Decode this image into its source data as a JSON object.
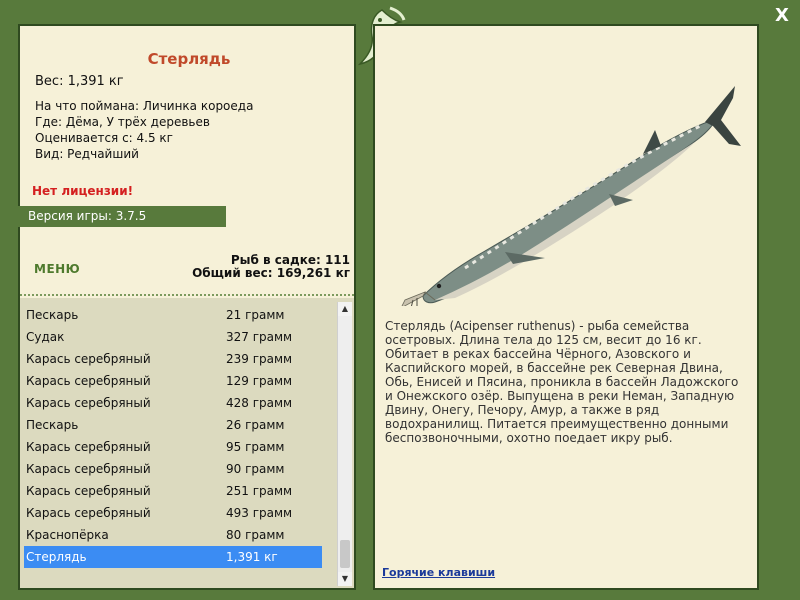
{
  "fish": {
    "name": "Стерлядь",
    "weight": "Вес: 1,391 кг",
    "info": [
      "На что поймана: Личинка короеда",
      "Где: Дёма, У трёх деревьев",
      "Оценивается с: 4.5 кг",
      "Вид: Редчайший"
    ]
  },
  "license_warning": "Нет лицензии!",
  "version": "Версия игры: 3.7.5",
  "menu_label": "МЕНЮ",
  "stats": {
    "count": "Рыб в садке: 111",
    "total": "Общий вес: 169,261 кг"
  },
  "catch_list": [
    {
      "name": "Пескарь",
      "weight": "21 грамм"
    },
    {
      "name": "Судак",
      "weight": "327 грамм"
    },
    {
      "name": "Карась серебряный",
      "weight": "239 грамм"
    },
    {
      "name": "Карась серебряный",
      "weight": "129 грамм"
    },
    {
      "name": "Карась серебряный",
      "weight": "428 грамм"
    },
    {
      "name": "Пескарь",
      "weight": "26 грамм"
    },
    {
      "name": "Карась серебряный",
      "weight": "95 грамм"
    },
    {
      "name": "Карась серебряный",
      "weight": "90 грамм"
    },
    {
      "name": "Карась серебряный",
      "weight": "251 грамм"
    },
    {
      "name": "Карась серебряный",
      "weight": "493 грамм"
    },
    {
      "name": "Краснопёрка",
      "weight": "80 грамм"
    },
    {
      "name": "Стерлядь",
      "weight": "1,391 кг",
      "selected": true
    }
  ],
  "description": "Стерлядь (Acipenser ruthenus) - рыба семейства осетровых. Длина тела до 125 см, весит до 16 кг. Обитает в реках бассейна Чёрного, Азовского и Каспийского морей, в бассейне рек Северная Двина, Обь, Енисей и Пясина, проникла в бассейн Ладожского и Онежского озёр. Выпущена в реки Неман, Западную Двину, Онегу, Печору, Амур, а также в ряд водохранилищ. Питается преимущественно донными беспозвоночными, охотно поедает икру рыб.",
  "hotkeys_label": "Горячие клавиши",
  "close_label": "X",
  "colors": {
    "frame": "#587a3c",
    "panel": "#f6f1d8",
    "title": "#c0492a",
    "warning": "#d42020",
    "selection": "#3b8cf3",
    "link": "#1b3a9a"
  },
  "icons": {
    "close": "close-icon",
    "logo": "fish-logo-icon",
    "fish_image": "sterlet-fish-image"
  }
}
